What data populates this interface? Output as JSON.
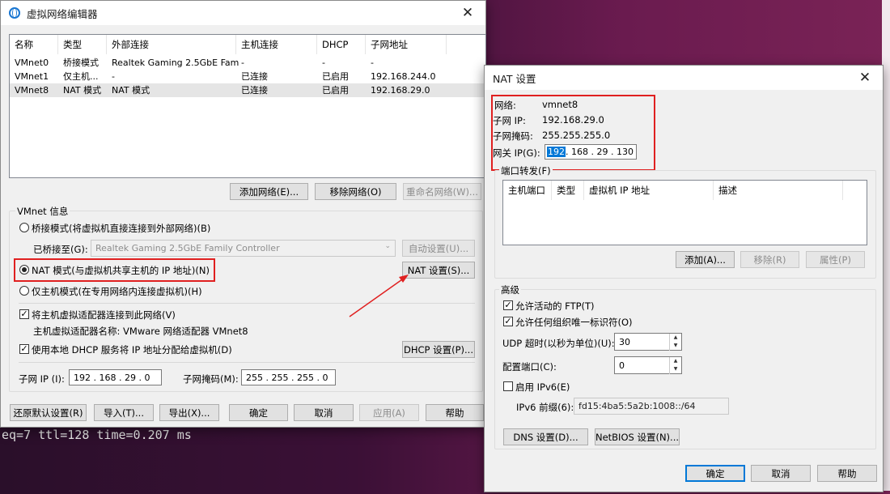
{
  "terminal_text": "eq=7 ttl=128 time=0.207 ms",
  "main": {
    "title": "虚拟网络编辑器",
    "columns": [
      "名称",
      "类型",
      "外部连接",
      "主机连接",
      "DHCP",
      "子网地址"
    ],
    "rows": [
      [
        "VMnet0",
        "桥接模式",
        "Realtek Gaming 2.5GbE Fam...",
        "-",
        "-",
        "-"
      ],
      [
        "VMnet1",
        "仅主机...",
        "-",
        "已连接",
        "已启用",
        "192.168.244.0"
      ],
      [
        "VMnet8",
        "NAT 模式",
        "NAT 模式",
        "已连接",
        "已启用",
        "192.168.29.0"
      ]
    ],
    "add_network": "添加网络(E)...",
    "remove_network": "移除网络(O)",
    "rename_network": "重命名网络(W)...",
    "vmnet_info": "VMnet 信息",
    "bridge_mode": "桥接模式(将虚拟机直接连接到外部网络)(B)",
    "bridged_to_label": "已桥接至(G):",
    "bridged_to_value": "Realtek Gaming 2.5GbE Family Controller",
    "auto_settings": "自动设置(U)...",
    "nat_mode": "NAT 模式(与虚拟机共享主机的 IP 地址)(N)",
    "nat_settings": "NAT 设置(S)...",
    "host_only": "仅主机模式(在专用网络内连接虚拟机)(H)",
    "connect_adapter": "将主机虚拟适配器连接到此网络(V)",
    "adapter_name": "主机虚拟适配器名称: VMware 网络适配器 VMnet8",
    "use_dhcp": "使用本地 DHCP 服务将 IP 地址分配给虚拟机(D)",
    "dhcp_settings": "DHCP 设置(P)...",
    "subnet_ip_label": "子网 IP (I):",
    "subnet_ip": "192 . 168 . 29 . 0",
    "subnet_mask_label": "子网掩码(M):",
    "subnet_mask": "255 . 255 . 255 . 0",
    "restore_defaults": "还原默认设置(R)",
    "import": "导入(T)...",
    "export": "导出(X)...",
    "ok": "确定",
    "cancel": "取消",
    "apply": "应用(A)",
    "help": "帮助"
  },
  "nat": {
    "title": "NAT 设置",
    "network_label": "网络:",
    "network_value": "vmnet8",
    "subnet_ip_label": "子网 IP:",
    "subnet_ip_value": "192.168.29.0",
    "subnet_mask_label": "子网掩码:",
    "subnet_mask_value": "255.255.255.0",
    "gateway_label": "网关 IP(G):",
    "gateway_selected": "192",
    "gateway_rest": " . 168 . 29 . 130",
    "port_forwarding": "端口转发(F)",
    "pf_columns": [
      "主机端口",
      "类型",
      "虚拟机 IP 地址",
      "描述"
    ],
    "add": "添加(A)...",
    "remove": "移除(R)",
    "properties": "属性(P)",
    "advanced": "高级",
    "allow_ftp": "允许活动的 FTP(T)",
    "allow_uid": "允许任何组织唯一标识符(O)",
    "udp_timeout_label": "UDP 超时(以秒为单位)(U):",
    "udp_timeout": "30",
    "config_port_label": "配置端口(C):",
    "config_port": "0",
    "enable_ipv6": "启用 IPv6(E)",
    "ipv6_prefix_label": "IPv6 前缀(6):",
    "ipv6_prefix": "fd15:4ba5:5a2b:1008::/64",
    "dns_settings": "DNS 设置(D)...",
    "netbios_settings": "NetBIOS 设置(N)...",
    "ok": "确定",
    "cancel": "取消",
    "help": "帮助"
  },
  "colors": {
    "highlight_red": "#e02020",
    "selection_blue": "#0078d7"
  }
}
